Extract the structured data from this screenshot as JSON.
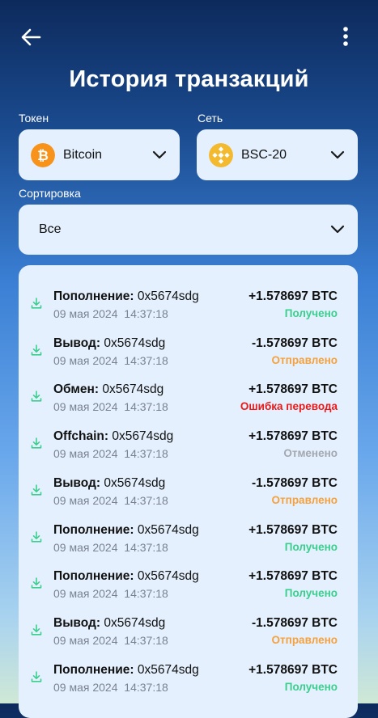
{
  "header": {
    "title": "История транзакций"
  },
  "filters": {
    "token_label": "Токен",
    "token_value": "Bitcoin",
    "network_label": "Сеть",
    "network_value": "BSC-20",
    "sort_label": "Сортировка",
    "sort_value": "Все"
  },
  "colors": {
    "received": "#3bcf8e",
    "sent": "#f5a13d",
    "error": "#e81a1a",
    "cancelled": "#a3a8b0",
    "bitcoin": "#f7931a",
    "bnb": "#f3ba2f"
  },
  "transactions": [
    {
      "type": "Пополнение:",
      "address": "0x5674sdg",
      "date": "09 мая 2024",
      "time": "14:37:18",
      "amount": "+1.578697 BTC",
      "status": "Получено",
      "status_kind": "received"
    },
    {
      "type": "Вывод:",
      "address": "0x5674sdg",
      "date": "09 мая 2024",
      "time": "14:37:18",
      "amount": "-1.578697 BTC",
      "status": "Отправлено",
      "status_kind": "sent"
    },
    {
      "type": "Обмен:",
      "address": "0x5674sdg",
      "date": "09 мая 2024",
      "time": "14:37:18",
      "amount": "+1.578697 BTC",
      "status": "Ошибка перевода",
      "status_kind": "error"
    },
    {
      "type": "Offchain:",
      "address": "0x5674sdg",
      "date": "09 мая 2024",
      "time": "14:37:18",
      "amount": "+1.578697 BTC",
      "status": "Отменено",
      "status_kind": "cancelled"
    },
    {
      "type": "Вывод:",
      "address": "0x5674sdg",
      "date": "09 мая 2024",
      "time": "14:37:18",
      "amount": "-1.578697 BTC",
      "status": "Отправлено",
      "status_kind": "sent"
    },
    {
      "type": "Пополнение:",
      "address": "0x5674sdg",
      "date": "09 мая 2024",
      "time": "14:37:18",
      "amount": "+1.578697 BTC",
      "status": "Получено",
      "status_kind": "received"
    },
    {
      "type": "Пополнение:",
      "address": "0x5674sdg",
      "date": "09 мая 2024",
      "time": "14:37:18",
      "amount": "+1.578697 BTC",
      "status": "Получено",
      "status_kind": "received"
    },
    {
      "type": "Вывод:",
      "address": "0x5674sdg",
      "date": "09 мая 2024",
      "time": "14:37:18",
      "amount": "-1.578697 BTC",
      "status": "Отправлено",
      "status_kind": "sent"
    },
    {
      "type": "Пополнение:",
      "address": "0x5674sdg",
      "date": "09 мая 2024",
      "time": "14:37:18",
      "amount": "+1.578697 BTC",
      "status": "Получено",
      "status_kind": "received"
    }
  ]
}
